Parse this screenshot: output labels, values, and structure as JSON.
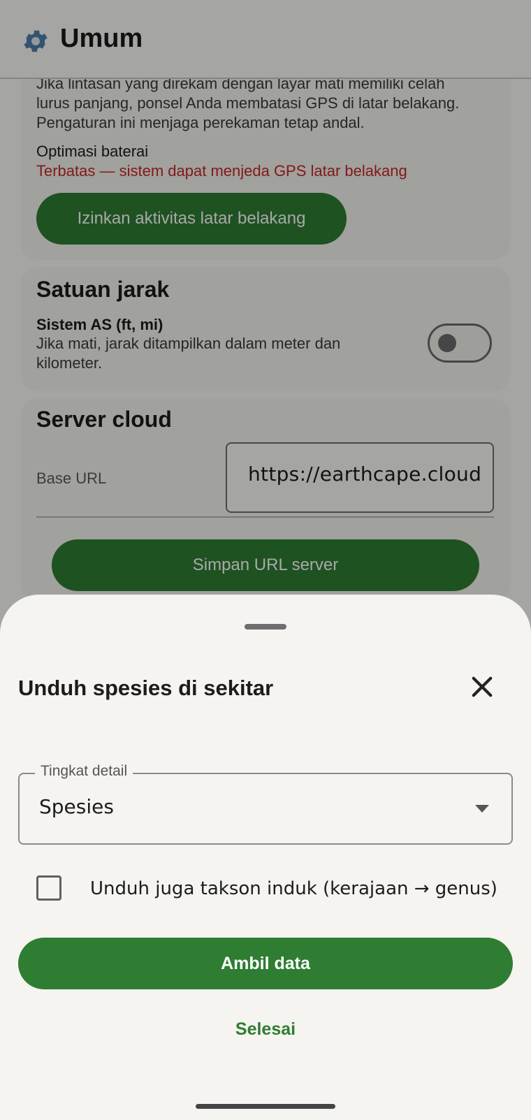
{
  "app_bar": {
    "title": "Umum",
    "icon": "gear-icon"
  },
  "battery_card": {
    "description_lines": [
      "Jika lintasan yang direkam dengan layar mati memiliki celah",
      "lurus panjang, ponsel Anda membatasi GPS di latar belakang.",
      "Pengaturan ini menjaga perekaman tetap andal."
    ],
    "optimization_label": "Optimasi baterai",
    "optimization_status": "Terbatas — sistem dapat menjeda GPS latar belakang",
    "allow_button": "Izinkan aktivitas latar belakang",
    "status_color": "#c62828"
  },
  "units_card": {
    "title": "Satuan jarak",
    "option_title": "Sistem AS (ft, mi)",
    "option_desc_lines": [
      "Jika mati, jarak ditampilkan dalam meter dan",
      "kilometer."
    ],
    "toggle_on": false
  },
  "server_card": {
    "title": "Server cloud",
    "field_label": "Base URL",
    "field_value": "https://earthcape.cloud",
    "save_button": "Simpan URL server"
  },
  "sheet": {
    "title": "Unduh spesies di sekitar",
    "detail_label": "Tingkat detail",
    "detail_value": "Spesies",
    "checkbox_label": "Unduh juga takson induk (kerajaan → genus)",
    "checkbox_checked": false,
    "fetch_button": "Ambil data",
    "done_button": "Selesai"
  },
  "colors": {
    "accent": "#2e7d32",
    "scrim": "rgba(0,0,0,0.34)"
  }
}
